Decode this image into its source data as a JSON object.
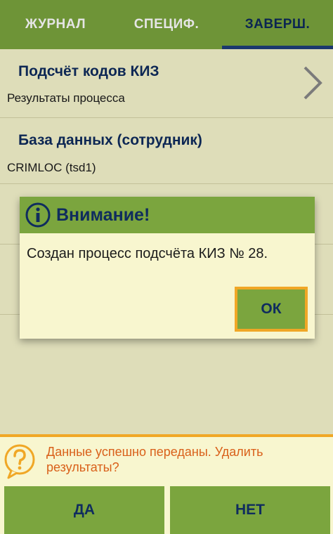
{
  "tabs": [
    {
      "label": "ЖУРНАЛ"
    },
    {
      "label": "СПЕЦИФ."
    },
    {
      "label": "ЗАВЕРШ."
    }
  ],
  "active_tab": "ЗАВЕРШ.",
  "rows": [
    {
      "title": "Подсчёт кодов КИЗ",
      "subtitle": "Результаты процесса"
    },
    {
      "title": "База данных (сотрудник)",
      "subtitle": "CRIMLOC (tsd1)"
    }
  ],
  "dialog": {
    "title": "Внимание!",
    "message": "Создан процесс подсчёта КИЗ № 28.",
    "ok_label": "ОК"
  },
  "prompt": {
    "text": "Данные успешно переданы. Удалить результаты?",
    "yes_label": "ДА",
    "no_label": "НЕТ"
  },
  "colors": {
    "accent_green": "#7ba53e",
    "background": "#f8f6cf",
    "title_blue": "#0f2c5e",
    "warning_orange": "#f0a726",
    "prompt_text": "#d9601a"
  },
  "icons": [
    "chevron-right-icon",
    "info-icon",
    "question-icon"
  ]
}
